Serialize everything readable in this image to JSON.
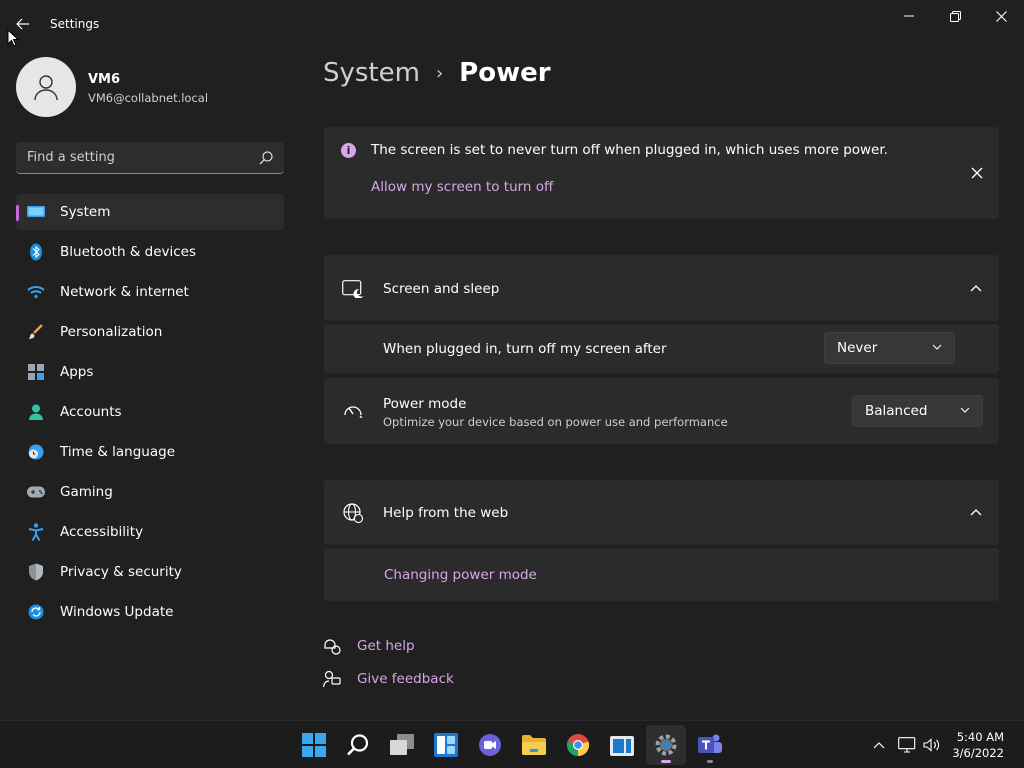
{
  "window": {
    "title": "Settings"
  },
  "profile": {
    "name": "VM6",
    "email": "VM6@collabnet.local"
  },
  "search": {
    "placeholder": "Find a setting"
  },
  "sidebar": {
    "items": [
      {
        "label": "System",
        "icon": "system-icon",
        "active": true
      },
      {
        "label": "Bluetooth & devices",
        "icon": "bluetooth-icon"
      },
      {
        "label": "Network & internet",
        "icon": "wifi-icon"
      },
      {
        "label": "Personalization",
        "icon": "brush-icon"
      },
      {
        "label": "Apps",
        "icon": "apps-icon"
      },
      {
        "label": "Accounts",
        "icon": "accounts-icon"
      },
      {
        "label": "Time & language",
        "icon": "clock-globe-icon"
      },
      {
        "label": "Gaming",
        "icon": "gamepad-icon"
      },
      {
        "label": "Accessibility",
        "icon": "accessibility-icon"
      },
      {
        "label": "Privacy & security",
        "icon": "shield-icon"
      },
      {
        "label": "Windows Update",
        "icon": "update-icon"
      }
    ]
  },
  "breadcrumb": {
    "parent": "System",
    "separator": "›",
    "current": "Power"
  },
  "notice": {
    "text": "The screen is set to never turn off when plugged in, which uses more power.",
    "link": "Allow my screen to turn off"
  },
  "screen_sleep": {
    "title": "Screen and sleep",
    "row_label": "When plugged in, turn off my screen after",
    "row_value": "Never"
  },
  "power_mode": {
    "title": "Power mode",
    "subtitle": "Optimize your device based on power use and performance",
    "value": "Balanced"
  },
  "help": {
    "title": "Help from the web",
    "link": "Changing power mode"
  },
  "footer": {
    "get_help": "Get help",
    "give_feedback": "Give feedback"
  },
  "taskbar": {
    "time": "5:40 AM",
    "date": "3/6/2022"
  },
  "colors": {
    "accent": "#d8a6e8",
    "background": "#202020",
    "card": "#2b2b2b",
    "active_indicator": "#c46ad8"
  }
}
